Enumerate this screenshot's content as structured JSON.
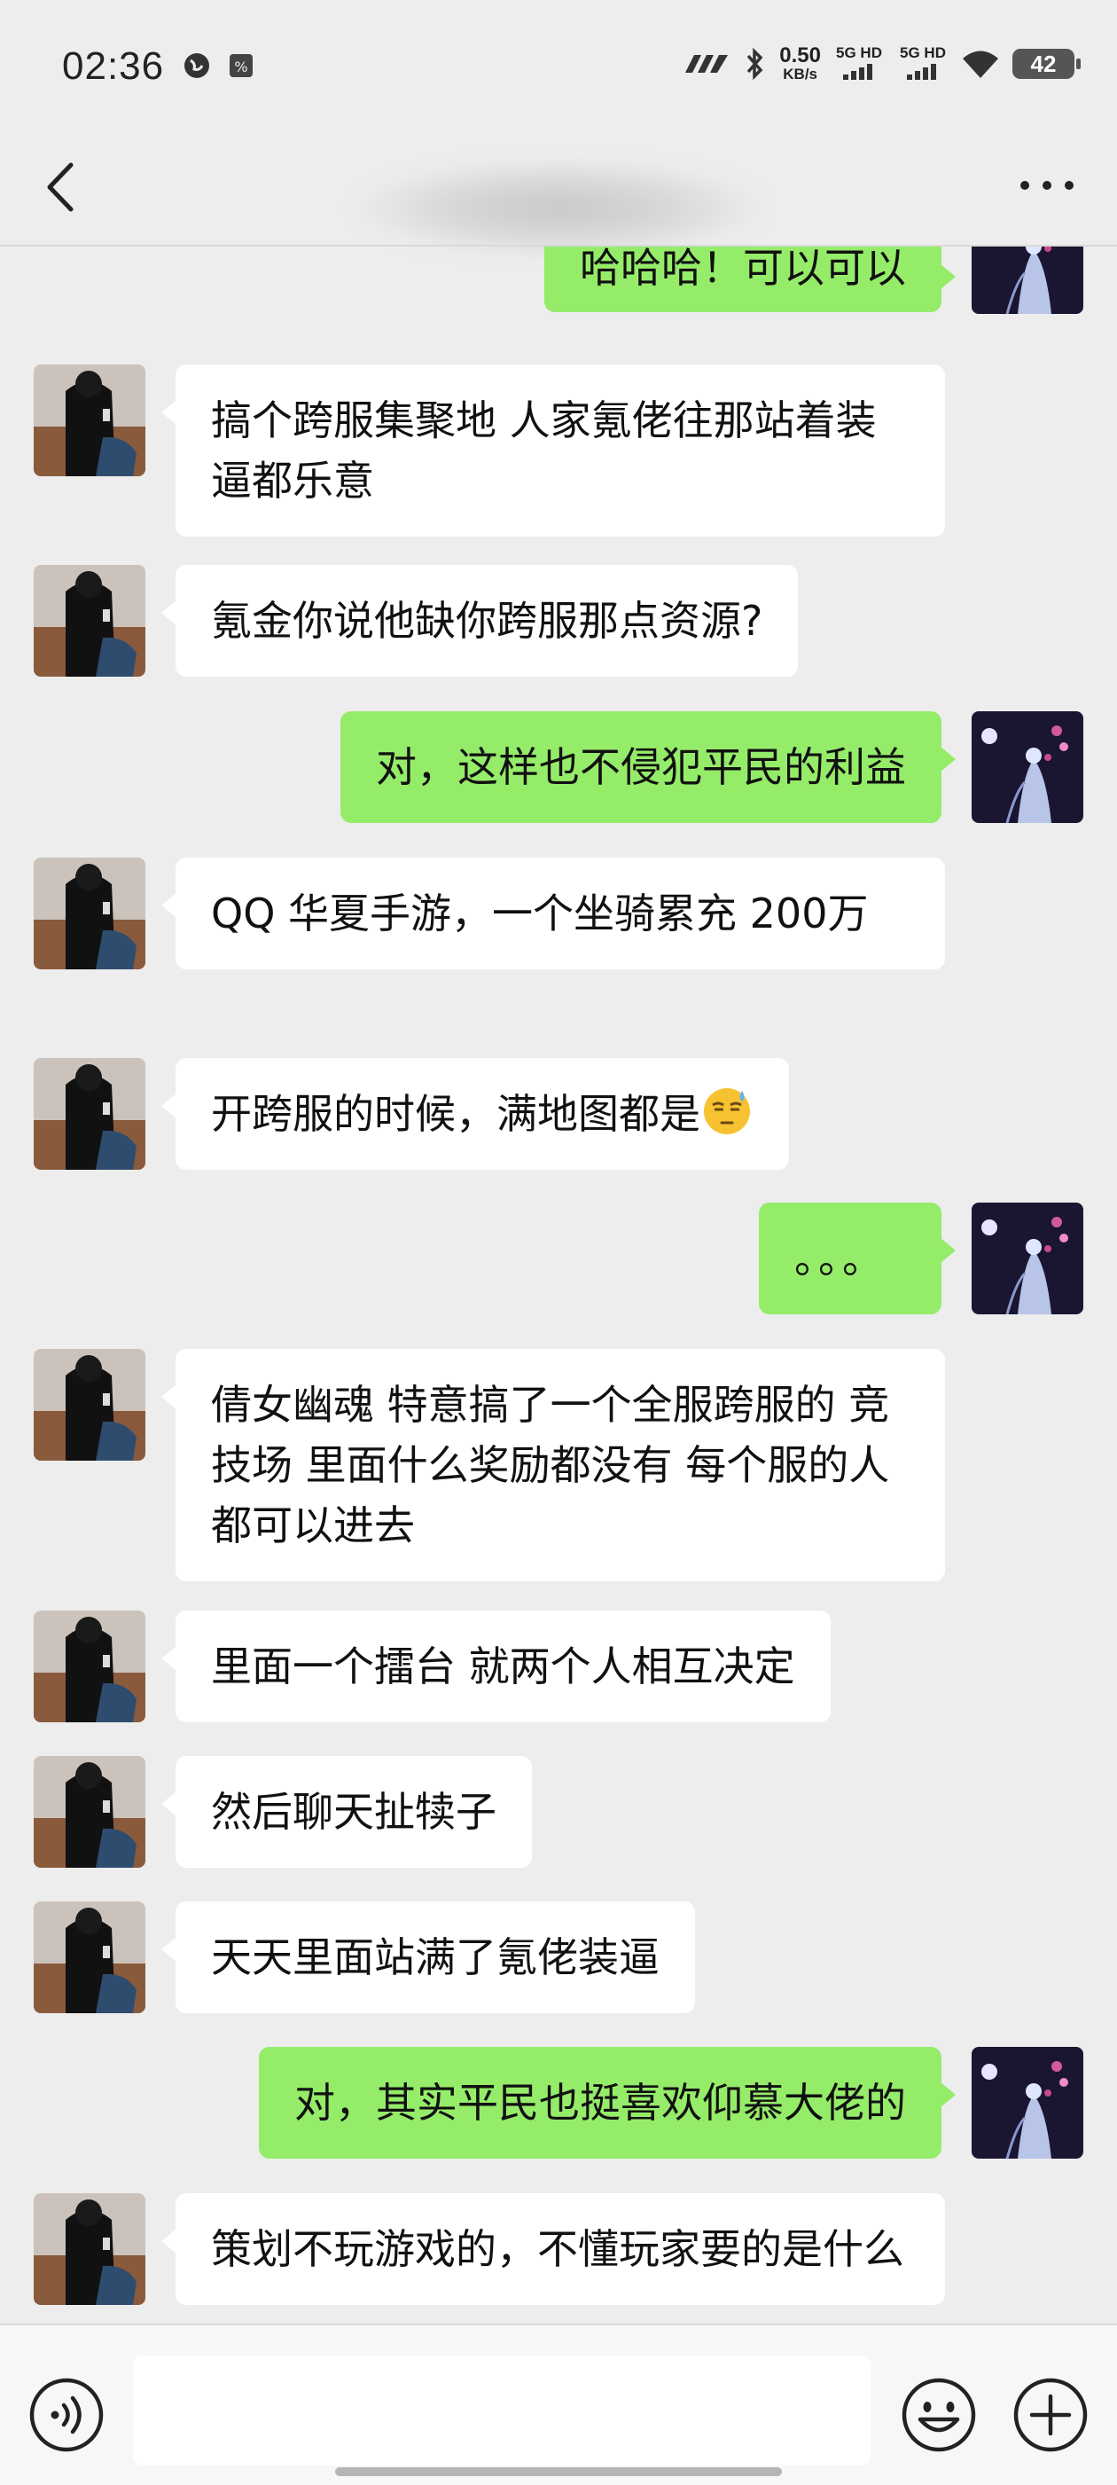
{
  "status_bar": {
    "time": "02:36",
    "net_speed_value": "0.50",
    "net_speed_unit": "KB/s",
    "sim1": "5G HD",
    "sim2": "5G HD",
    "battery": "42"
  },
  "header": {
    "back_icon": "chevron-left-icon",
    "more_icon": "ellipsis-icon"
  },
  "messages": [
    {
      "side": "right",
      "text": "哈哈哈！可以可以"
    },
    {
      "side": "left",
      "text": "搞个跨服集聚地 人家氪佬往那站着装逼都乐意"
    },
    {
      "side": "left",
      "text": "氪金你说他缺你跨服那点资源?"
    },
    {
      "side": "right",
      "text": "对，这样也不侵犯平民的利益"
    },
    {
      "side": "left",
      "text": "QQ 华夏手游，一个坐骑累充 200万"
    },
    {
      "side": "left",
      "text": "开跨服的时候，满地图都是",
      "emoji": "cold-sweat-emoji"
    },
    {
      "side": "right",
      "text": "。。。"
    },
    {
      "side": "left",
      "text": "倩女幽魂 特意搞了一个全服跨服的 竞技场 里面什么奖励都没有 每个服的人都可以进去"
    },
    {
      "side": "left",
      "text": "里面一个擂台 就两个人相互决定"
    },
    {
      "side": "left",
      "text": "然后聊天扯犊子"
    },
    {
      "side": "left",
      "text": "天天里面站满了氪佬装逼"
    },
    {
      "side": "right",
      "text": "对，其实平民也挺喜欢仰慕大佬的"
    },
    {
      "side": "left",
      "text": "策划不玩游戏的，不懂玩家要的是什么"
    }
  ],
  "input_bar": {
    "text_value": "",
    "voice_icon": "voice-icon",
    "emoji_icon": "emoji-icon",
    "plus_icon": "plus-icon"
  },
  "colors": {
    "background": "#ededed",
    "sent_bubble": "#95ec69",
    "received_bubble": "#ffffff"
  }
}
